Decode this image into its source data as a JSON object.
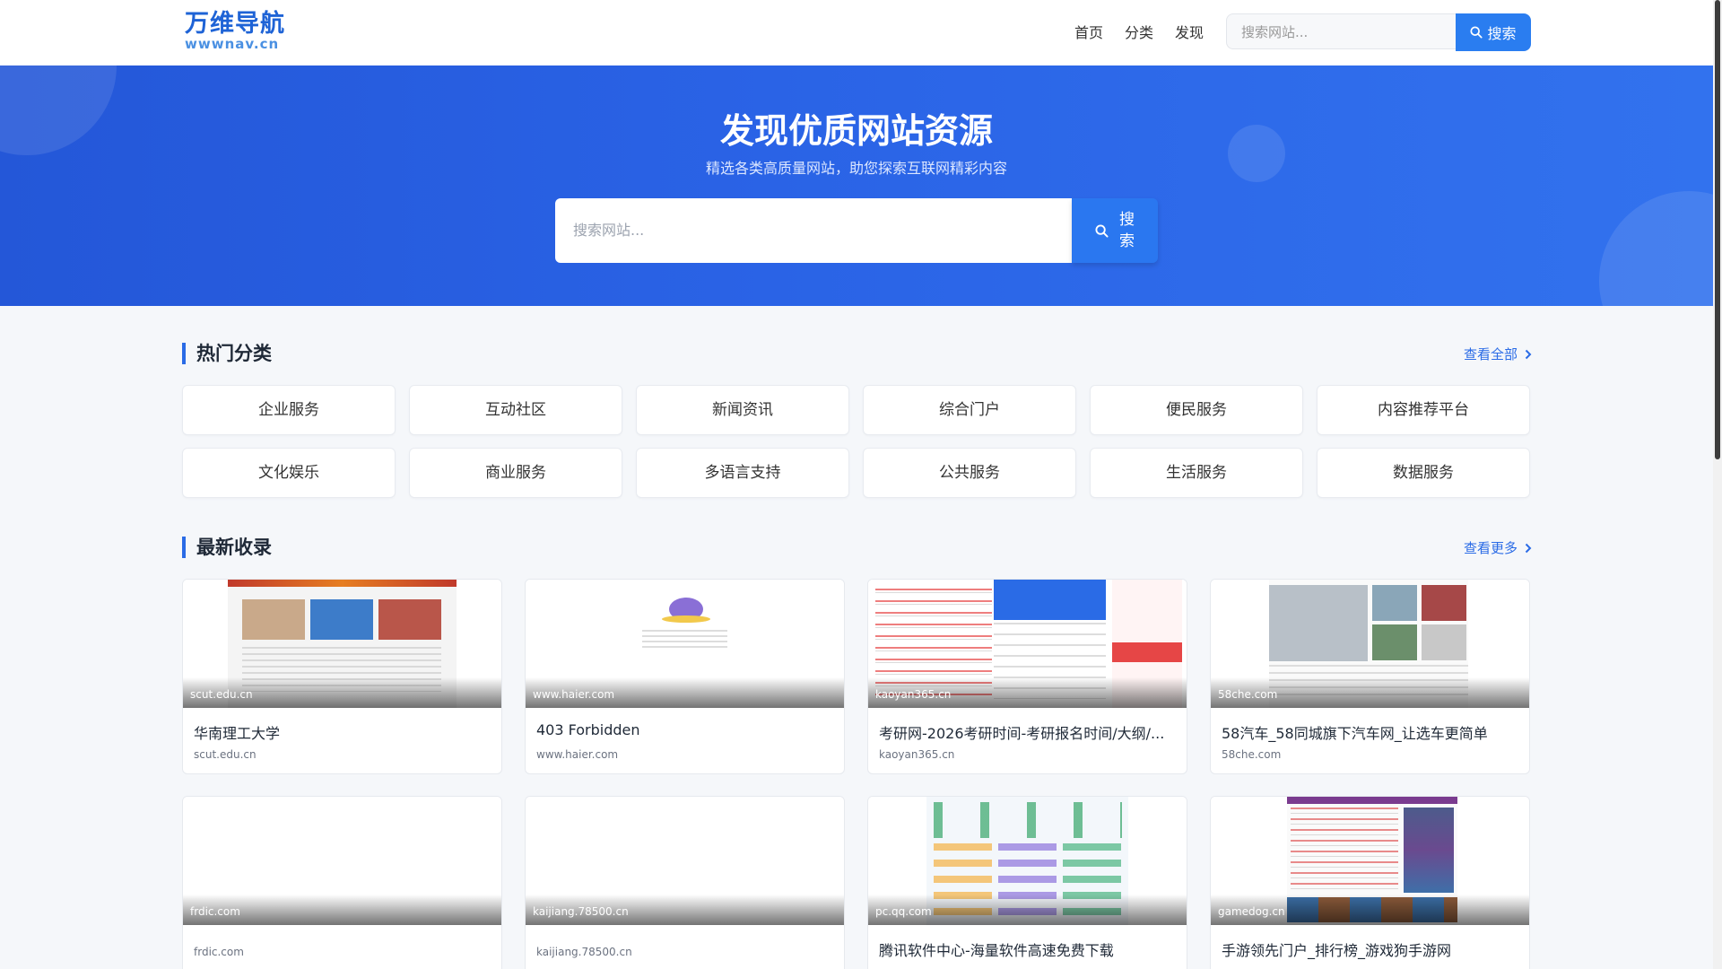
{
  "header": {
    "logo_cn": "万维导航",
    "logo_en": "wwwnav.cn",
    "nav": [
      "首页",
      "分类",
      "发现"
    ],
    "search_placeholder": "搜索网站...",
    "search_button": "搜索"
  },
  "hero": {
    "title": "发现优质网站资源",
    "subtitle": "精选各类高质量网站，助您探索互联网精彩内容",
    "search_placeholder": "搜索网站...",
    "search_button": "搜索"
  },
  "categories_section": {
    "title": "热门分类",
    "more": "查看全部",
    "items": [
      "企业服务",
      "互动社区",
      "新闻资讯",
      "综合门户",
      "便民服务",
      "内容推荐平台",
      "文化娱乐",
      "商业服务",
      "多语言支持",
      "公共服务",
      "生活服务",
      "数据服务"
    ]
  },
  "latest_section": {
    "title": "最新收录",
    "more": "查看更多",
    "cards": [
      {
        "domain": "scut.edu.cn",
        "title": "华南理工大学"
      },
      {
        "domain": "www.haier.com",
        "title": "403 Forbidden"
      },
      {
        "domain": "kaoyan365.cn",
        "title": "考研网-2026考研时间-考研报名时间/大纲/..."
      },
      {
        "domain": "58che.com",
        "title": "58汽车_58同城旗下汽车网_让选车更简单"
      },
      {
        "domain": "frdic.com",
        "title": ""
      },
      {
        "domain": "kaijiang.78500.cn",
        "title": ""
      },
      {
        "domain": "pc.qq.com",
        "title": "腾讯软件中心-海量软件高速免费下载"
      },
      {
        "domain": "gamedog.cn",
        "title": "手游领先门户_排行榜_游戏狗手游网"
      }
    ]
  },
  "colors": {
    "primary": "#2a6be6",
    "hero_start": "#2457d8",
    "hero_end": "#3272ee"
  }
}
